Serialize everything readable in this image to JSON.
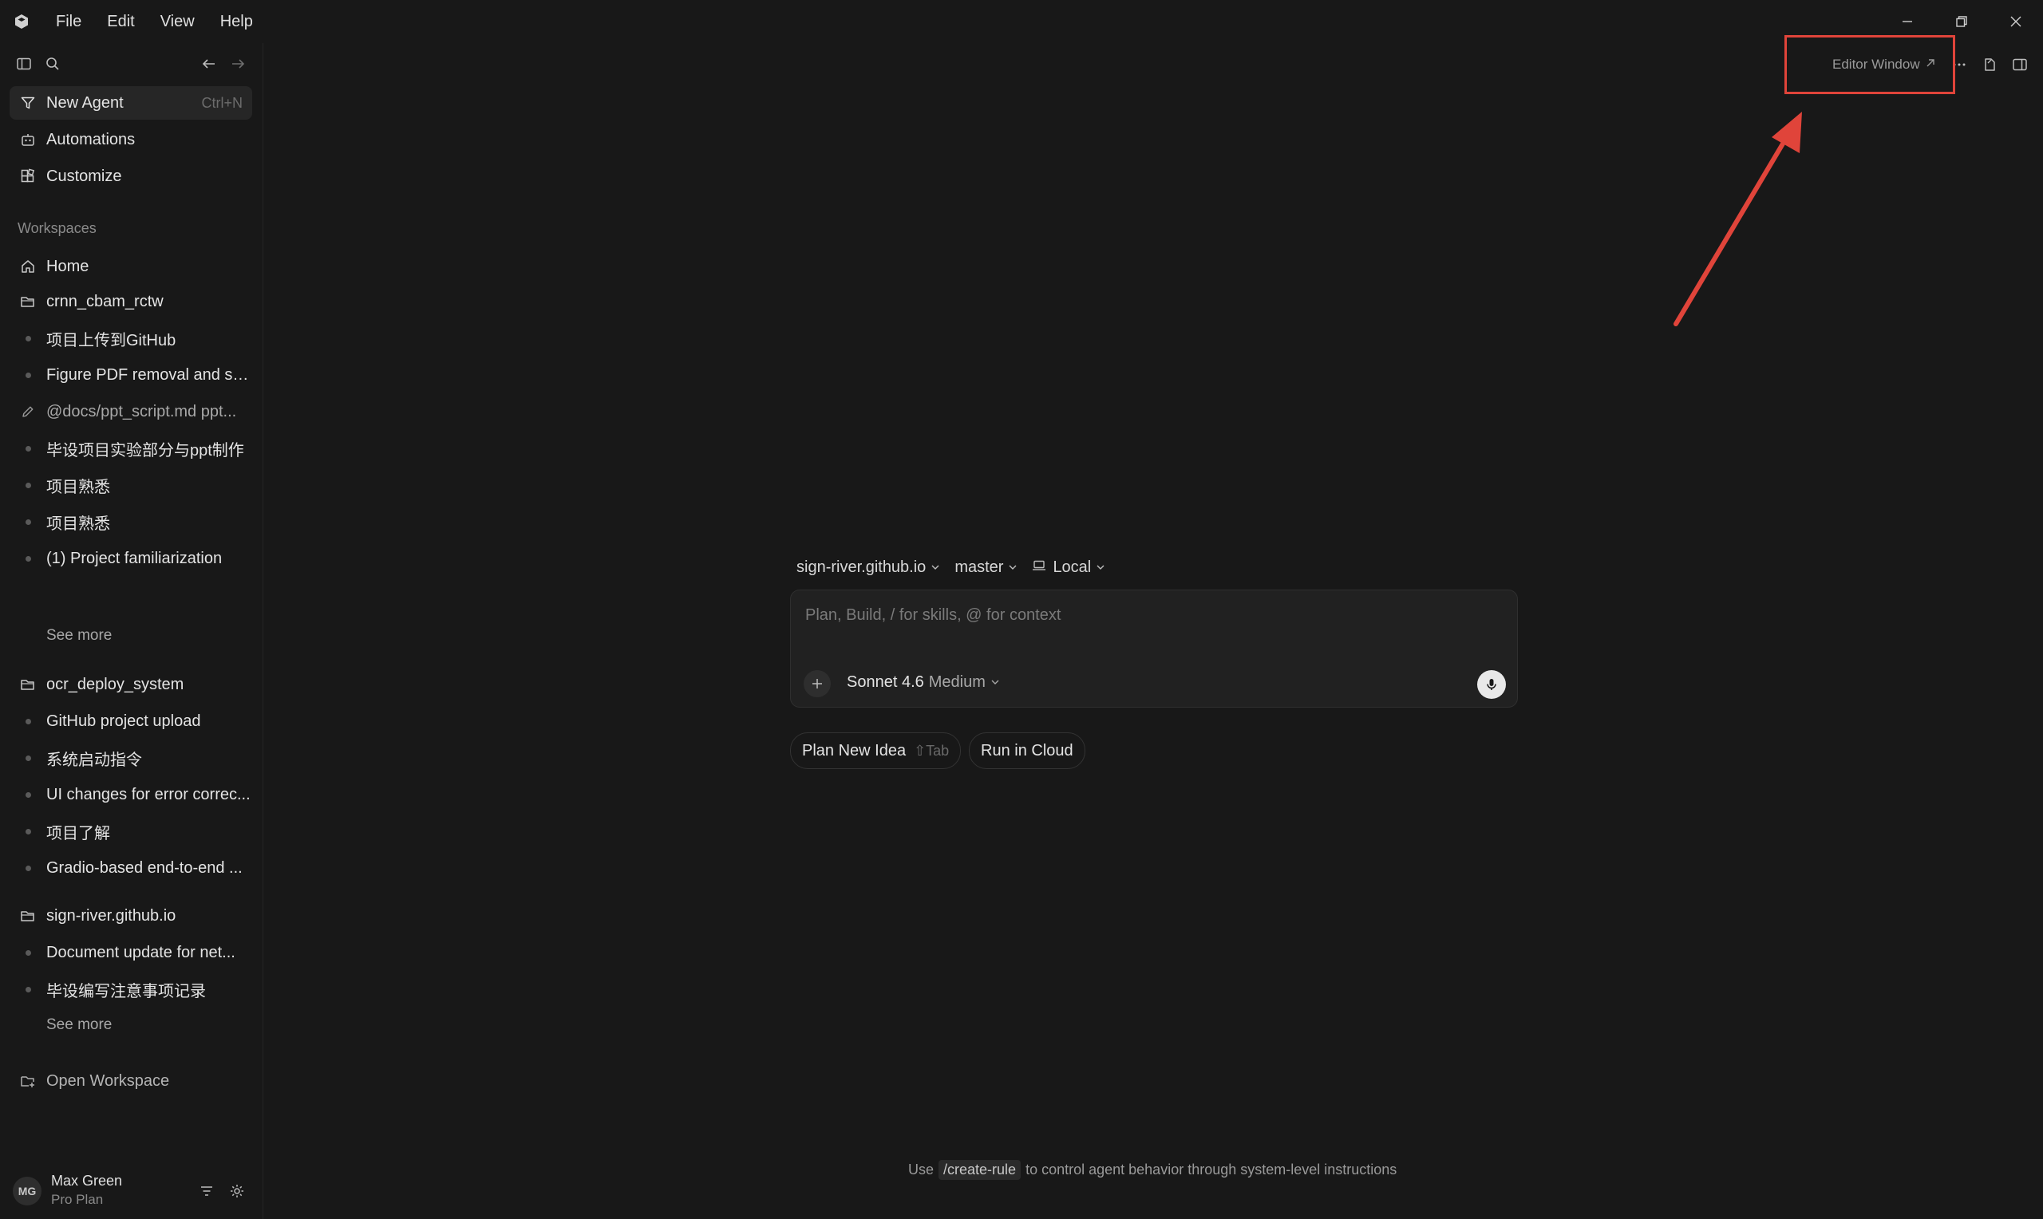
{
  "menu": {
    "file": "File",
    "edit": "Edit",
    "view": "View",
    "help": "Help"
  },
  "sidebar": {
    "new_agent": {
      "label": "New Agent",
      "shortcut": "Ctrl+N"
    },
    "automations": "Automations",
    "customize": "Customize",
    "workspaces_title": "Workspaces",
    "home": "Home",
    "workspaces": [
      {
        "name": "crnn_cbam_rctw",
        "items": [
          "项目上传到GitHub",
          "Figure PDF removal and sc...",
          "@docs/ppt_script.md ppt...",
          "毕设项目实验部分与ppt制作",
          "项目熟悉",
          "项目熟悉",
          "(1) Project familiarization"
        ],
        "see_more": "See more"
      },
      {
        "name": "ocr_deploy_system",
        "items": [
          "GitHub project upload",
          "系统启动指令",
          "UI changes for error correc...",
          "项目了解",
          "Gradio-based end-to-end ..."
        ]
      },
      {
        "name": "sign-river.github.io",
        "items": [
          "Document update for net...",
          "毕设编写注意事项记录"
        ],
        "see_more": "See more"
      }
    ],
    "open_workspace": "Open Workspace",
    "user": {
      "initials": "MG",
      "name": "Max Green",
      "plan": "Pro Plan"
    }
  },
  "topbar": {
    "editor_window": "Editor Window"
  },
  "composer": {
    "repo": "sign-river.github.io",
    "branch": "master",
    "location": "Local",
    "placeholder": "Plan, Build, / for skills, @ for context",
    "model": "Sonnet 4.6",
    "effort": "Medium"
  },
  "actions": {
    "plan_new_idea": "Plan New Idea",
    "plan_hint": "⇧Tab",
    "run_in_cloud": "Run in Cloud"
  },
  "footer": {
    "prefix": "Use",
    "command": "/create-rule",
    "suffix": "to control agent behavior through system-level instructions"
  },
  "annotation": {
    "color": "#e0443a"
  }
}
